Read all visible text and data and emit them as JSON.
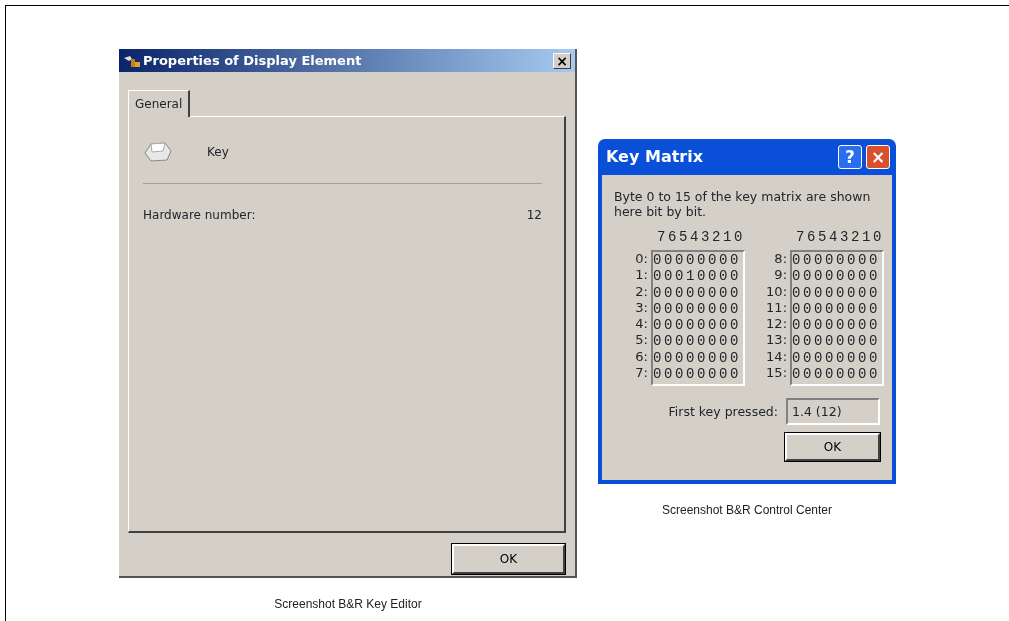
{
  "properties_dialog": {
    "title": "Properties of Display Element",
    "close_button": "×",
    "tabs": [
      {
        "label": "General",
        "selected": true
      }
    ],
    "element_name": "Key",
    "fields": [
      {
        "label": "Hardware number:",
        "value": "12"
      }
    ],
    "ok_button": "OK",
    "caption": "Screenshot B&R Key Editor"
  },
  "key_matrix_dialog": {
    "title": "Key Matrix",
    "help_button": "?",
    "close_button": "×",
    "description": "Byte 0 to 15 of the key matrix are shown here bit by bit.",
    "matrices": [
      {
        "header": "76543210",
        "rows": [
          {
            "label": "0:",
            "bits": "00000000"
          },
          {
            "label": "1:",
            "bits": "00010000"
          },
          {
            "label": "2:",
            "bits": "00000000"
          },
          {
            "label": "3:",
            "bits": "00000000"
          },
          {
            "label": "4:",
            "bits": "00000000"
          },
          {
            "label": "5:",
            "bits": "00000000"
          },
          {
            "label": "6:",
            "bits": "00000000"
          },
          {
            "label": "7:",
            "bits": "00000000"
          }
        ]
      },
      {
        "header": "76543210",
        "rows": [
          {
            "label": "8:",
            "bits": "00000000"
          },
          {
            "label": "9:",
            "bits": "00000000"
          },
          {
            "label": "10:",
            "bits": "00000000"
          },
          {
            "label": "11:",
            "bits": "00000000"
          },
          {
            "label": "12:",
            "bits": "00000000"
          },
          {
            "label": "13:",
            "bits": "00000000"
          },
          {
            "label": "14:",
            "bits": "00000000"
          },
          {
            "label": "15:",
            "bits": "00000000"
          }
        ]
      }
    ],
    "first_key": {
      "label": "First key pressed:",
      "value": "1.4 (12)"
    },
    "ok_button": "OK",
    "caption": "Screenshot B&R Control Center"
  }
}
